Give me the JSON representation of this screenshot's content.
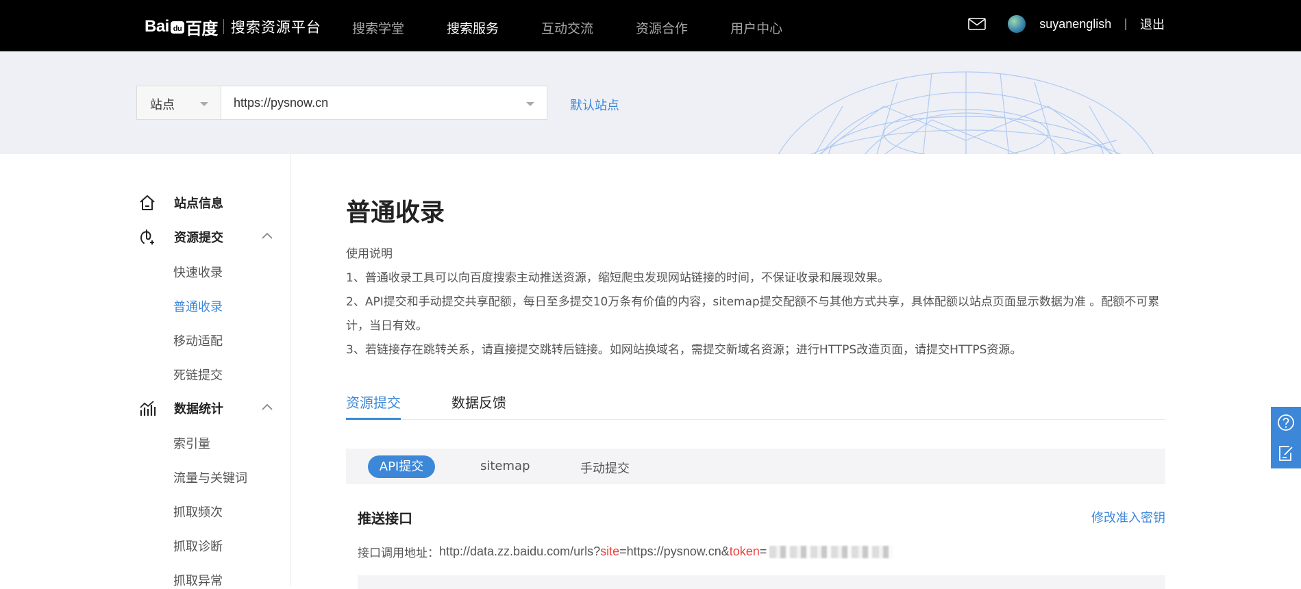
{
  "header": {
    "logo_text": "Bai",
    "logo_text2": "百度",
    "platform": "搜索资源平台",
    "nav": [
      {
        "label": "搜索学堂",
        "active": false
      },
      {
        "label": "搜索服务",
        "active": true
      },
      {
        "label": "互动交流",
        "active": false
      },
      {
        "label": "资源合作",
        "active": false
      },
      {
        "label": "用户中心",
        "active": false
      }
    ],
    "mail_icon": "mail-icon",
    "username": "suyanenglish",
    "separator": "|",
    "logout": "退出"
  },
  "site_bar": {
    "type_select": "站点",
    "site_url": "https://pysnow.cn",
    "default_site": "默认站点"
  },
  "sidebar": {
    "site_info": "站点信息",
    "resource_submit": {
      "label": "资源提交",
      "items": [
        "快速收录",
        "普通收录",
        "移动适配",
        "死链提交"
      ],
      "active_item": "普通收录"
    },
    "data_stats": {
      "label": "数据统计",
      "items": [
        "索引量",
        "流量与关键词",
        "抓取频次",
        "抓取诊断",
        "抓取异常"
      ]
    }
  },
  "main": {
    "title": "普通收录",
    "usage_title": "使用说明",
    "usage_lines": [
      "1、普通收录工具可以向百度搜索主动推送资源，缩短爬虫发现网站链接的时间，不保证收录和展现效果。",
      "2、API提交和手动提交共享配额，每日至多提交10万条有价值的内容，sitemap提交配额不与其他方式共享，具体配额以站点页面显示数据为准 。配额不可累计，当日有效。",
      "3、若链接存在跳转关系，请直接提交跳转后链接。如网站换域名，需提交新域名资源；进行HTTPS改造页面，请提交HTTPS资源。"
    ],
    "tabs": [
      "资源提交",
      "数据反馈"
    ],
    "active_tab": "资源提交",
    "subtabs": [
      "API提交",
      "sitemap",
      "手动提交"
    ],
    "active_subtab": "API提交",
    "push_title": "推送接口",
    "modify_key": "修改准入密钥",
    "endpoint": {
      "label": "接口调用地址：",
      "prefix": "http://data.zz.baidu.com/urls?",
      "site_key": "site",
      "site_value": "=https://pysnow.cn&",
      "token_key": "token",
      "token_value": "="
    }
  },
  "colors": {
    "accent": "#3c87d8",
    "topbar": "#000000",
    "banner": "#eef0f6",
    "param_red": "#e8413e"
  }
}
